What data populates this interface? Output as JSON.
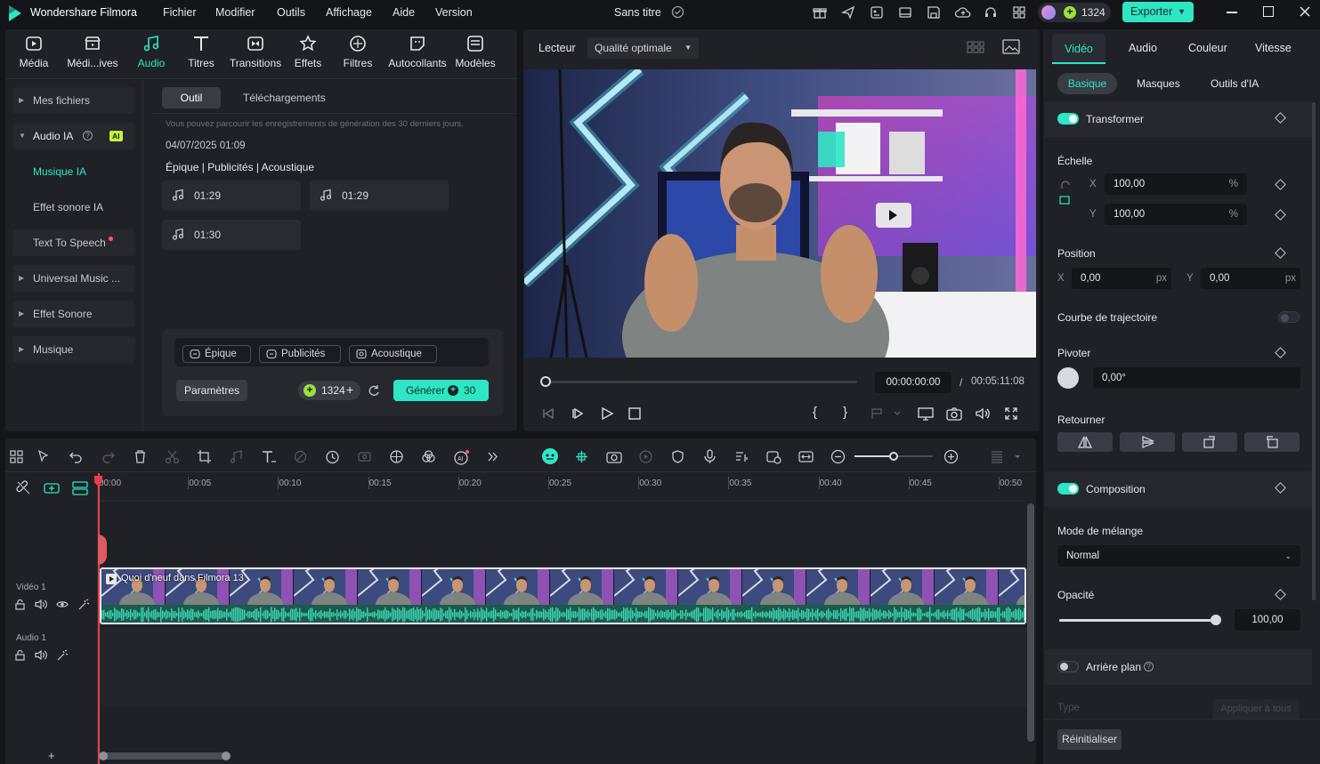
{
  "app": {
    "name": "Wondershare Filmora",
    "project_title": "Sans titre",
    "credits": "1324",
    "export_label": "Exporter"
  },
  "menu": [
    "Fichier",
    "Modifier",
    "Outils",
    "Affichage",
    "Aide",
    "Version"
  ],
  "library_tabs": [
    {
      "label": "Média",
      "icon": "media-icon"
    },
    {
      "label": "Médi...ives",
      "icon": "stock-media-icon"
    },
    {
      "label": "Audio",
      "icon": "music-note-icon"
    },
    {
      "label": "Titres",
      "icon": "title-t-icon"
    },
    {
      "label": "Transitions",
      "icon": "transitions-icon"
    },
    {
      "label": "Effets",
      "icon": "effects-star-icon"
    },
    {
      "label": "Filtres",
      "icon": "filters-icon"
    },
    {
      "label": "Autocollants",
      "icon": "stickers-icon"
    },
    {
      "label": "Modèles",
      "icon": "templates-icon"
    }
  ],
  "sidebar": {
    "mes_fichiers": "Mes fichiers",
    "audio_ia": "Audio IA",
    "ai_badge": "AI",
    "musique_ia": "Musique IA",
    "effet_sonore_ia": "Effet sonore IA",
    "tts": "Text To Speech",
    "universal": "Universal Music ...",
    "effet_sonore": "Effet Sonore",
    "musique": "Musique"
  },
  "audio_panel": {
    "tab_outil": "Outil",
    "tab_downloads": "Téléchargements",
    "info": "Vous pouvez parcourir les enregistrements de génération des 30 derniers jours.",
    "date": "04/07/2025 01:09",
    "tags_line": "Épique | Publicités | Acoustique",
    "tracks": [
      "01:29",
      "01:29",
      "01:30"
    ],
    "chips": [
      "Épique",
      "Publicités",
      "Acoustique"
    ],
    "params": "Paramètres",
    "credits": "1324",
    "generate": "Générer",
    "generate_cost": "30"
  },
  "player": {
    "label": "Lecteur",
    "quality": "Qualité optimale",
    "current_time": "00:00:00:00",
    "separator": "/",
    "total_time": "00:05:11:08",
    "progress": 0.0
  },
  "right_panel": {
    "tabs": [
      "Vidéo",
      "Audio",
      "Couleur",
      "Vitesse"
    ],
    "subtabs": [
      "Basique",
      "Masques",
      "Outils d'IA"
    ],
    "transform": "Transformer",
    "scale": "Échelle",
    "scale_x": "100,00",
    "scale_y": "100,00",
    "percent": "%",
    "x": "X",
    "y": "Y",
    "position": "Position",
    "pos_x": "0,00",
    "pos_y": "0,00",
    "px": "px",
    "trajectory": "Courbe de trajectoire",
    "rotate": "Pivoter",
    "rotate_value": "0,00°",
    "flip": "Retourner",
    "composition": "Composition",
    "blend_mode": "Mode de mélange",
    "blend_value": "Normal",
    "opacity": "Opacité",
    "opacity_value": "100,00",
    "opacity_level": 1.0,
    "background": "Arrière plan",
    "type": "Type",
    "apply_all": "Appliquer à tous",
    "reset": "Réinitialiser"
  },
  "timeline": {
    "ruler": [
      "00:00",
      "00:05",
      "00:10",
      "00:15",
      "00:20",
      "00:25",
      "00:30",
      "00:35",
      "00:40",
      "00:45",
      "00:50"
    ],
    "video_track": "Vidéo 1",
    "audio_track": "Audio 1",
    "clip_title": "Quoi d'neuf dans Filmora 13",
    "zoom_level": 0.5,
    "add": "+"
  },
  "colors": {
    "accent": "#2ee6c4",
    "bg": "#141519",
    "panel": "#1f2127",
    "playhead": "#e8404a"
  }
}
